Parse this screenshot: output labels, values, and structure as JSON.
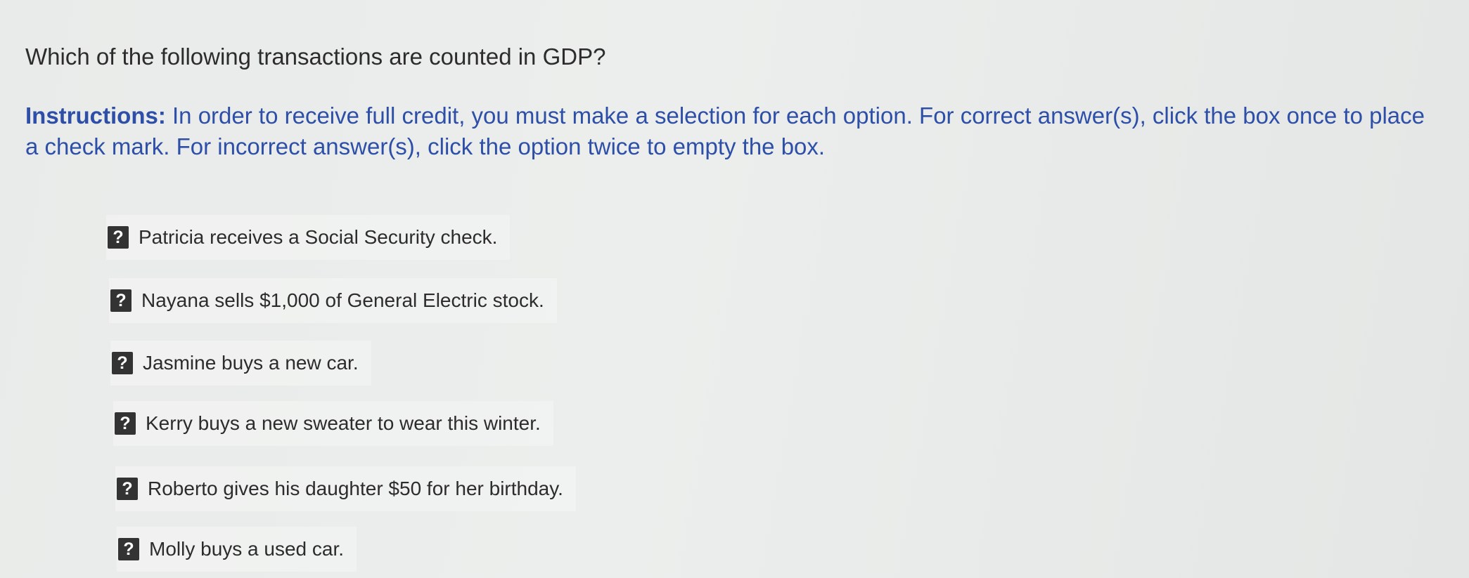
{
  "question": "Which of the following transactions are counted in GDP?",
  "instructions": {
    "lead": "Instructions:",
    "body": " In order to receive full credit, you must make a selection for each option. For correct answer(s), click the box once to place a check mark. For incorrect answer(s), click the option twice to empty the box."
  },
  "options": [
    {
      "marker": "?",
      "label": "Patricia receives a Social Security check."
    },
    {
      "marker": "?",
      "label": "Nayana sells $1,000 of General Electric stock."
    },
    {
      "marker": "?",
      "label": "Jasmine buys a new car."
    },
    {
      "marker": "?",
      "label": "Kerry buys a new sweater to wear this winter."
    },
    {
      "marker": "?",
      "label": "Roberto gives his daughter $50 for her birthday."
    },
    {
      "marker": "?",
      "label": "Molly buys a used car."
    }
  ],
  "colors": {
    "instruction_text": "#2d4fa8",
    "marker_bg": "#333333"
  }
}
